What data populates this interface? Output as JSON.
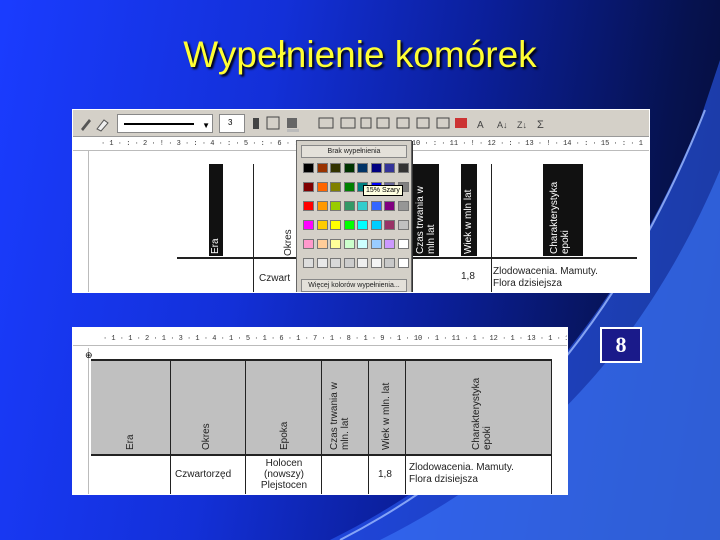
{
  "slide": {
    "title": "Wypełnienie komórek",
    "page_number": "8"
  },
  "colors": {
    "background": "#1330d8",
    "title": "#ffff33",
    "accent": "#3a6bff"
  },
  "toolbar": {
    "font_size": "3",
    "icons": [
      "pencil-icon",
      "eraser-icon",
      "line-style-dropdown",
      "line-weight-dropdown",
      "border-color-icon",
      "borders-icon",
      "shading-color-icon",
      "insert-table-icon",
      "merge-cells-icon",
      "split-cells-icon",
      "align-icon",
      "distribute-rows-icon",
      "distribute-columns-icon",
      "autoformat-icon",
      "text-direction-icon",
      "sort-ascending-icon",
      "sort-descending-icon",
      "autosum-icon"
    ]
  },
  "ruler_top": "· 1 · : · 2 · ! · 3 · : · 4 · : · 5 · : · 6 · : · 7 · : · 8 · : · 9 · ! · 10 · : · 11 · ! · 12 · : · 13 · ! · 14 · : · 15 · : · 1",
  "ruler_bottom": "· 1 · 1 · 2 · 1 · 3 · 1 · 4 · 1 · 5 · 1 · 6 · 1 · 7 · 1 · 8 · 1 · 9 · 1 · 10 · 1 · 11 · 1 · 12 · 1 · 13 · 1 · 14 · 1 · 15 · 1",
  "palette": {
    "no_fill_label": "Brak wypełnienia",
    "more_label": "Więcej kolorów wypełnienia...",
    "tooltip": "15% Szary",
    "swatches": [
      [
        "#000000",
        "#993300",
        "#333300",
        "#003300",
        "#003366",
        "#000080",
        "#333399",
        "#333333"
      ],
      [
        "#800000",
        "#ff6600",
        "#808000",
        "#008000",
        "#008080",
        "#0000ff",
        "#666699",
        "#808080"
      ],
      [
        "#ff0000",
        "#ff9900",
        "#99cc00",
        "#339966",
        "#33cccc",
        "#3366ff",
        "#800080",
        "#969696"
      ],
      [
        "#ff00ff",
        "#ffcc00",
        "#ffff00",
        "#00ff00",
        "#00ffff",
        "#00ccff",
        "#993366",
        "#c0c0c0"
      ],
      [
        "#ff99cc",
        "#ffcc99",
        "#ffff99",
        "#ccffcc",
        "#ccffff",
        "#99ccff",
        "#cc99ff",
        "#ffffff"
      ],
      [
        "#dddddd",
        "#e8e8e8",
        "#d8d8d8",
        "#cccccc",
        "#eeeeee",
        "#f4f4f4",
        "#c8c8c8",
        "#ffffff"
      ]
    ]
  },
  "table_top": {
    "headers": [
      "Era",
      "Okres",
      "Czas trwania w mln lat",
      "Wiek w mln lat",
      "Charakterystyka epoki"
    ],
    "row1": {
      "col1": "Czwart",
      "col4": "1,8",
      "col5": "Zlodowacenia. Mamuty. Flora dzisiejsza"
    }
  },
  "table_bottom": {
    "headers": [
      "Era",
      "Okres",
      "Epoka",
      "Czas trwania w mln. lat",
      "Wiek w mln. lat",
      "Charakterystyka epoki"
    ],
    "row1": {
      "col2": "Czwartorzęd",
      "col3": "Holocen (nowszy)\nPlejstocen",
      "col5": "1,8",
      "col6": "Zlodowacenia. Mamuty.\nFlora dzisiejsza"
    }
  }
}
